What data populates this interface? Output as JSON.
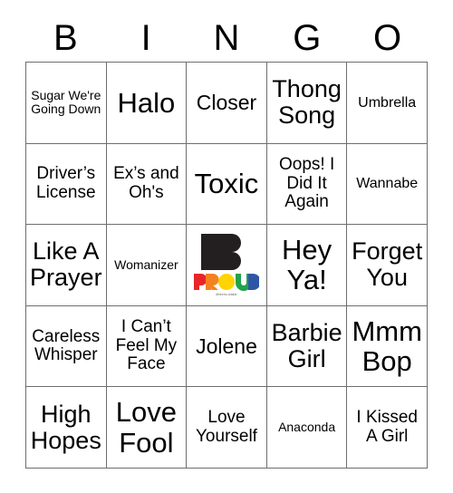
{
  "card": {
    "header_letters": [
      "B",
      "I",
      "N",
      "G",
      "O"
    ],
    "grid": [
      [
        {
          "text": "Sugar We're Going Down",
          "size": "xs"
        },
        {
          "text": "Halo",
          "size": "xxl"
        },
        {
          "text": "Closer",
          "size": "l"
        },
        {
          "text": "Thong Song",
          "size": "xl"
        },
        {
          "text": "Umbrella",
          "size": "s"
        }
      ],
      [
        {
          "text": "Driver’s License",
          "size": "m"
        },
        {
          "text": "Ex’s and Oh's",
          "size": "m"
        },
        {
          "text": "Toxic",
          "size": "xxl"
        },
        {
          "text": "Oops! I Did It Again",
          "size": "m"
        },
        {
          "text": "Wannabe",
          "size": "s"
        }
      ],
      [
        {
          "text": "Like A Prayer",
          "size": "xl"
        },
        {
          "text": "Womanizer",
          "size": "xs"
        },
        {
          "text": "",
          "size": "s",
          "free_space": true
        },
        {
          "text": "Hey Ya!",
          "size": "xxl"
        },
        {
          "text": "Forget You",
          "size": "xl"
        }
      ],
      [
        {
          "text": "Careless Whisper",
          "size": "m"
        },
        {
          "text": "I Can’t Feel My Face",
          "size": "m"
        },
        {
          "text": "Jolene",
          "size": "l"
        },
        {
          "text": "Barbie Girl",
          "size": "xl"
        },
        {
          "text": "Mmm Bop",
          "size": "xxl"
        }
      ],
      [
        {
          "text": "High Hopes",
          "size": "xl"
        },
        {
          "text": "Love Fool",
          "size": "xxl"
        },
        {
          "text": "Love Yourself",
          "size": "m"
        },
        {
          "text": "Anaconda",
          "size": "xs"
        },
        {
          "text": "I Kissed A Girl",
          "size": "m"
        }
      ]
    ],
    "free_space_logo": {
      "letter": "B",
      "word": "PROUD",
      "tagline": "#bechu-wakki",
      "letter_color": "#231f20",
      "word_colors": [
        "#e8262a",
        "#f58220",
        "#ffd400",
        "#22a34a",
        "#2e56a6"
      ]
    }
  }
}
